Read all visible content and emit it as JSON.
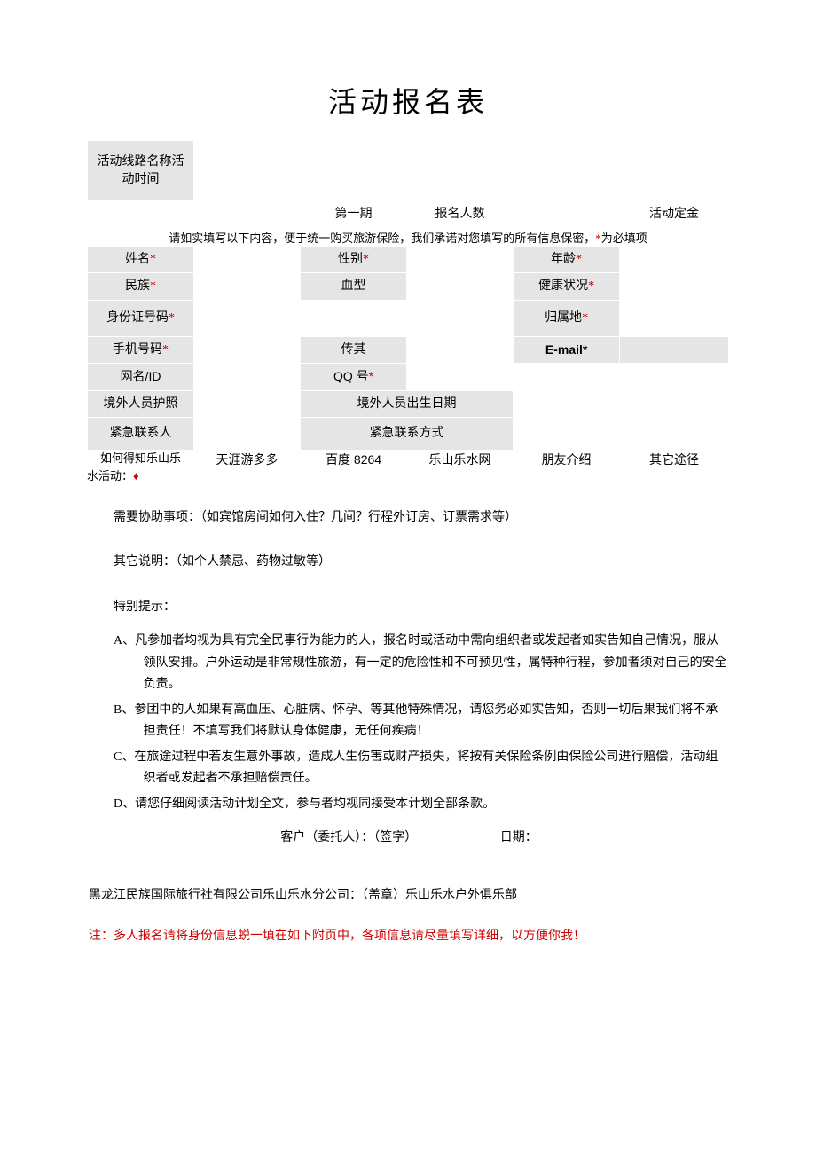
{
  "title": "活动报名表",
  "header": {
    "route_label": "活动线路名称活动时间",
    "phase": "第一期",
    "count_label": "报名人数",
    "deposit_label": "活动定金"
  },
  "instruction": {
    "prefix": "请如实填写以下内容，便于统一购买旅游保险，我们承诺对您填写的所有信息保密，",
    "mark": "*",
    "suffix": "为必填项"
  },
  "fields": {
    "name": "姓名",
    "gender": "性别",
    "age": "年龄",
    "ethnic": "民族",
    "blood": "血型",
    "health": "健康状况",
    "idnum": "身份证号码",
    "home": "归属地",
    "mobile": "手机号码",
    "fax": "传其",
    "email": "E-mail*",
    "netid": "网名/ID",
    "qq": "QQ 号",
    "passport": "境外人员护照",
    "birth": "境外人员出生日期",
    "emerg_person": "紧急联系人",
    "emerg_contact": "紧急联系方式"
  },
  "source": {
    "label_line1": "如何得知乐山乐",
    "label_line2": "水活动：",
    "diamond": "♦",
    "options": [
      "天涯游多多",
      "百度 8264",
      "乐山乐水网",
      "朋友介绍",
      "其它途径"
    ]
  },
  "paras": {
    "assist": "需要协助事项：（如宾馆房间如何入住？几间？行程外订房、订票需求等）",
    "other": "其它说明：（如个人禁忌、药物过敏等）",
    "tips_heading": "特别提示：",
    "A": "A、凡参加者均视为具有完全民事行为能力的人，报名时或活动中需向组织者或发起者如实告知自己情况，服从领队安排。户外运动是非常规性旅游，有一定的危险性和不可预见性，属特种行程，参加者须对自己的安全负责。",
    "B": "B、参团中的人如果有高血压、心脏病、怀孕、等其他特殊情况，请您务必如实告知，否则一切后果我们将不承担责任！不填写我们将默认身体健康，无任何疾病！",
    "C": "C、在旅途过程中若发生意外事故，造成人生伤害或财产损失，将按有关保险条例由保险公司进行赔偿，活动组织者或发起者不承担赔偿责任。",
    "D": "D、请您仔细阅读活动计划全文，参与者均视同接受本计划全部条款。",
    "sig_label": "客户（委托人）：（签字）",
    "sig_date": "日期：",
    "org": "黑龙江民族国际旅行社有限公司乐山乐水分公司：（盖章）乐山乐水户外俱乐部",
    "note": "注：多人报名请将身份信息蜕一填在如下附页中，各项信息请尽量填写详细，以方便你我！"
  }
}
